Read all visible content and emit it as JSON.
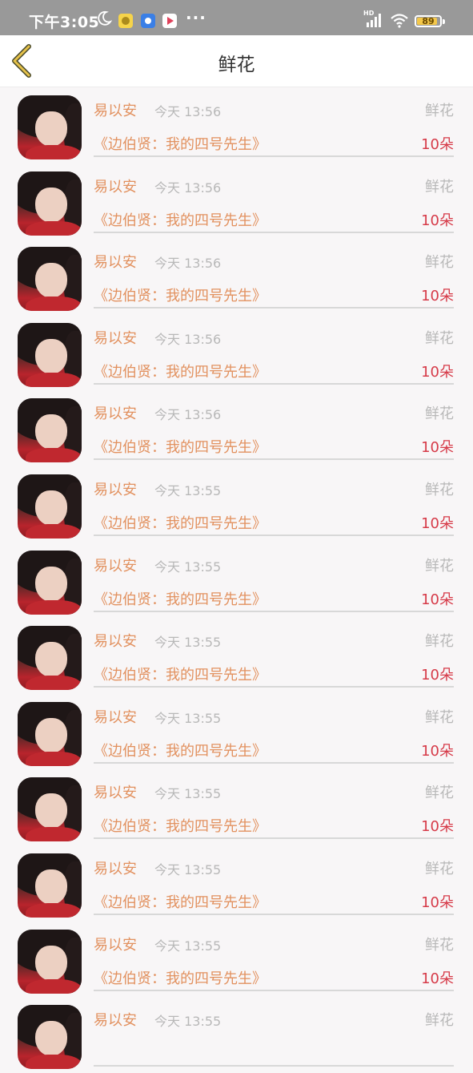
{
  "status_bar": {
    "time": "下午3:05",
    "network_label": "HD",
    "battery": "89",
    "battery_level": 0.89
  },
  "header": {
    "title": "鲜花"
  },
  "list": [
    {
      "name": "易以安",
      "time": "今天 13:56",
      "type": "鲜花",
      "book": "《边伯贤：我的四号先生》",
      "count": "10朵"
    },
    {
      "name": "易以安",
      "time": "今天 13:56",
      "type": "鲜花",
      "book": "《边伯贤：我的四号先生》",
      "count": "10朵"
    },
    {
      "name": "易以安",
      "time": "今天 13:56",
      "type": "鲜花",
      "book": "《边伯贤：我的四号先生》",
      "count": "10朵"
    },
    {
      "name": "易以安",
      "time": "今天 13:56",
      "type": "鲜花",
      "book": "《边伯贤：我的四号先生》",
      "count": "10朵"
    },
    {
      "name": "易以安",
      "time": "今天 13:56",
      "type": "鲜花",
      "book": "《边伯贤：我的四号先生》",
      "count": "10朵"
    },
    {
      "name": "易以安",
      "time": "今天 13:55",
      "type": "鲜花",
      "book": "《边伯贤：我的四号先生》",
      "count": "10朵"
    },
    {
      "name": "易以安",
      "time": "今天 13:55",
      "type": "鲜花",
      "book": "《边伯贤：我的四号先生》",
      "count": "10朵"
    },
    {
      "name": "易以安",
      "time": "今天 13:55",
      "type": "鲜花",
      "book": "《边伯贤：我的四号先生》",
      "count": "10朵"
    },
    {
      "name": "易以安",
      "time": "今天 13:55",
      "type": "鲜花",
      "book": "《边伯贤：我的四号先生》",
      "count": "10朵"
    },
    {
      "name": "易以安",
      "time": "今天 13:55",
      "type": "鲜花",
      "book": "《边伯贤：我的四号先生》",
      "count": "10朵"
    },
    {
      "name": "易以安",
      "time": "今天 13:55",
      "type": "鲜花",
      "book": "《边伯贤：我的四号先生》",
      "count": "10朵"
    },
    {
      "name": "易以安",
      "time": "今天 13:55",
      "type": "鲜花",
      "book": "《边伯贤：我的四号先生》",
      "count": "10朵"
    },
    {
      "name": "易以安",
      "time": "今天 13:55",
      "type": "鲜花",
      "book": "",
      "count": ""
    }
  ],
  "icons": {
    "back": "chevron-left-icon",
    "moon": "moon-icon",
    "signal": "signal-icon",
    "wifi": "wifi-icon",
    "battery": "battery-icon"
  },
  "colors": {
    "accent": "#e2915f",
    "count": "#d63a48",
    "back_icon": "#c9a13a",
    "status_bar": "#999999"
  }
}
